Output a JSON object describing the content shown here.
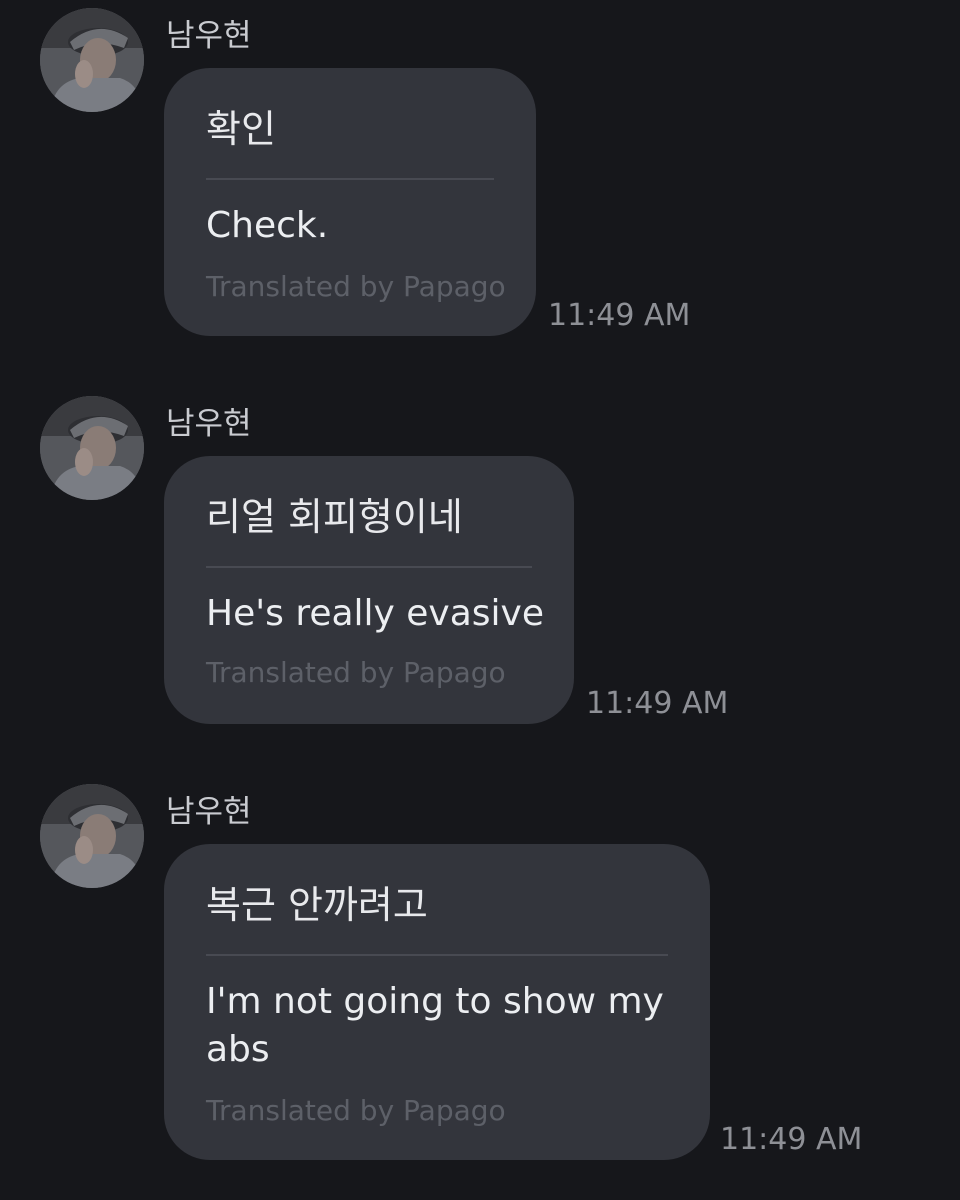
{
  "messages": [
    {
      "sender": "남우현",
      "avatar_icon": "user-avatar-photo",
      "original": "확인",
      "translated": "Check.",
      "credit": "Translated by Papago",
      "time": "11:49 AM"
    },
    {
      "sender": "남우현",
      "avatar_icon": "user-avatar-photo",
      "original": "리얼 회피형이네",
      "translated": "He's really evasive",
      "credit": "Translated by Papago",
      "time": "11:49 AM"
    },
    {
      "sender": "남우현",
      "avatar_icon": "user-avatar-photo",
      "original": "복근 안까려고",
      "translated": "I'm not going to show my abs",
      "credit": "Translated by Papago",
      "time": "11:49 AM"
    }
  ],
  "colors": {
    "background": "#16171b",
    "bubble": "#33353c",
    "divider": "#484a52",
    "credit_text": "#5d6068",
    "time_text": "#8e9096"
  }
}
